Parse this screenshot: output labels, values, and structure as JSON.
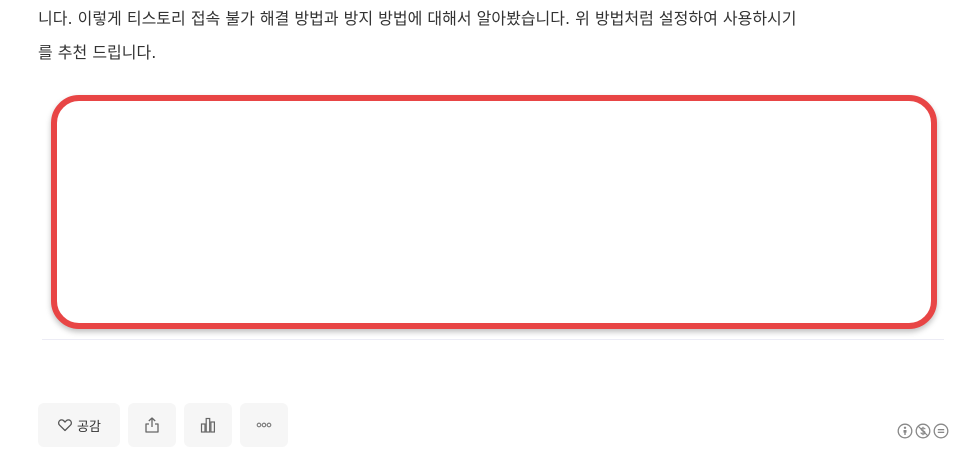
{
  "article": {
    "lines": [
      "니다. 이렇게 티스토리 접속 불가 해결 방법과 방지 방법에 대해서 알아봤습니다. 위 방법처럼 설정하여 사용하시기",
      "를 추천 드립니다."
    ]
  },
  "actions": {
    "like_label": "공감",
    "like_icon": "heart-icon",
    "share_icon": "share-icon",
    "stats_icon": "bar-chart-icon",
    "more_icon": "more-icon"
  },
  "license": {
    "icons": [
      "cc-attribution-icon",
      "cc-noncommercial-icon",
      "cc-noderivs-icon"
    ]
  },
  "colors": {
    "highlight_border": "#e84545",
    "button_bg": "#f6f6f6",
    "text": "#333333"
  }
}
